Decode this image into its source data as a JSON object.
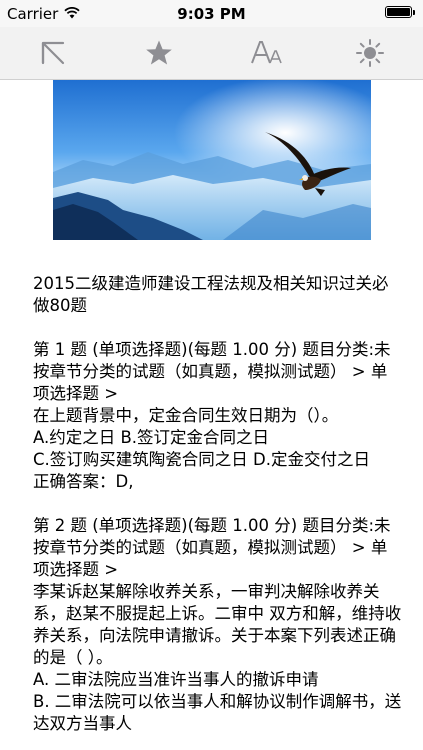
{
  "status_bar": {
    "carrier": "Carrier",
    "time": "9:03 PM"
  },
  "toolbar": {
    "icons": [
      "exit-arrow-icon",
      "star-icon",
      "font-size-icon",
      "brightness-icon"
    ],
    "icon_color": "#8e8e93"
  },
  "article": {
    "title": "2015二级建造师建设工程法规及相关知识过关必做80题",
    "q1": {
      "header": "第 1 题 (单项选择题)(每题 1.00 分) 题目分类:未按章节分类的试题（如真题，模拟测试题） > 单项选择题 >",
      "stem": "在上题背景中，定金合同生效日期为（）。",
      "options_ab": "A.约定之日 B.签订定金合同之日",
      "options_cd": "C.签订购买建筑陶瓷合同之日 D.定金交付之日",
      "answer": "正确答案：D,"
    },
    "q2": {
      "header": "第 2 题 (单项选择题)(每题 1.00 分) 题目分类:未按章节分类的试题（如真题，模拟测试题） > 单项选择题 >",
      "stem": "李某诉赵某解除收养关系，一审判决解除收养关系，赵某不服提起上诉。二审中 双方和解，维持收养关系，向法院申请撤诉。关于本案下列表述正确的是（ ）。",
      "option_a": "A. 二审法院应当准许当事人的撤诉申请",
      "option_b": "B. 二审法院可以依当事人和解协议制作调解书，送达双方当事人"
    }
  }
}
